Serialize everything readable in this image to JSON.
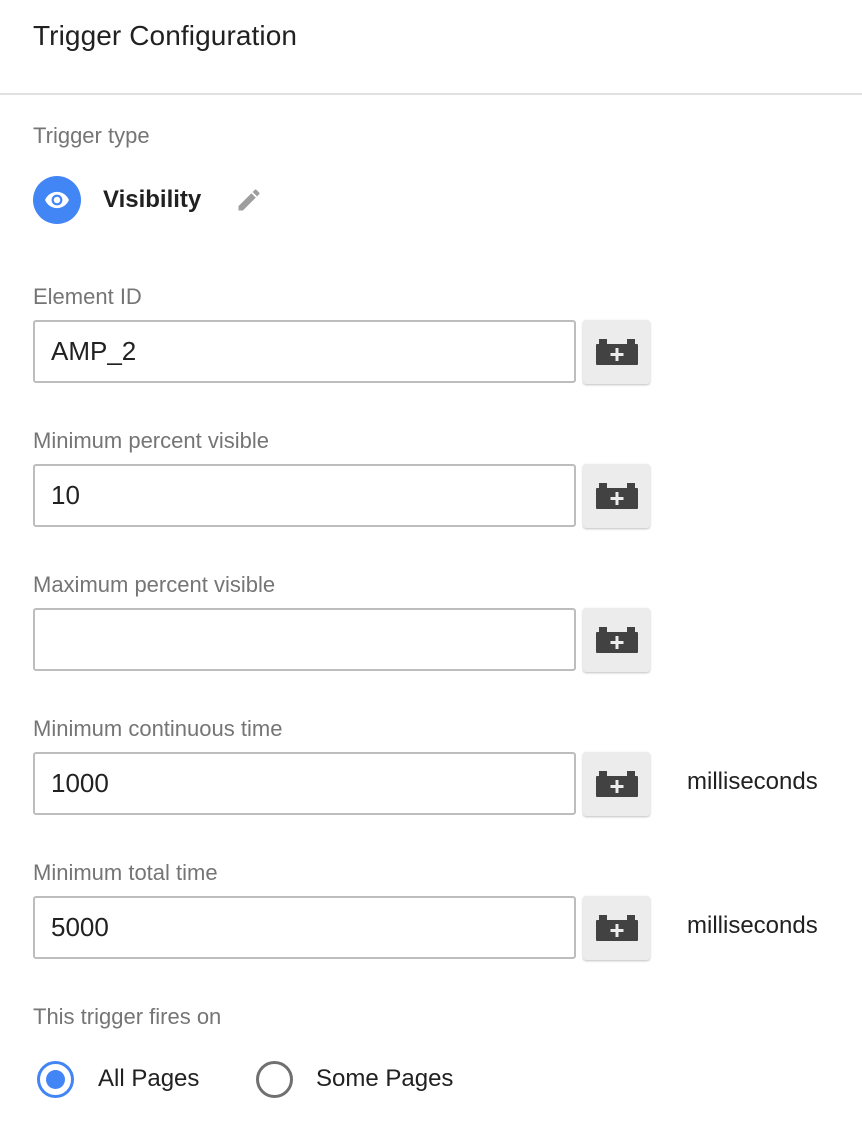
{
  "header": {
    "title": "Trigger Configuration"
  },
  "trigger_type": {
    "label": "Trigger type",
    "value": "Visibility",
    "icon": "eye-icon",
    "accent_color": "#4285f4"
  },
  "fields": {
    "element_id": {
      "label": "Element ID",
      "value": "AMP_2",
      "placeholder": ""
    },
    "min_percent": {
      "label": "Minimum percent visible",
      "value": "10",
      "placeholder": ""
    },
    "max_percent": {
      "label": "Maximum percent visible",
      "value": "",
      "placeholder": ""
    },
    "min_continuous": {
      "label": "Minimum continuous time",
      "value": "1000",
      "placeholder": "",
      "unit": "milliseconds"
    },
    "min_total": {
      "label": "Minimum total time",
      "value": "5000",
      "placeholder": "",
      "unit": "milliseconds"
    }
  },
  "variable_button_icon": "add-variable-icon",
  "fires_on": {
    "label": "This trigger fires on",
    "options": [
      {
        "label": "All Pages",
        "selected": true
      },
      {
        "label": "Some Pages",
        "selected": false
      }
    ]
  }
}
